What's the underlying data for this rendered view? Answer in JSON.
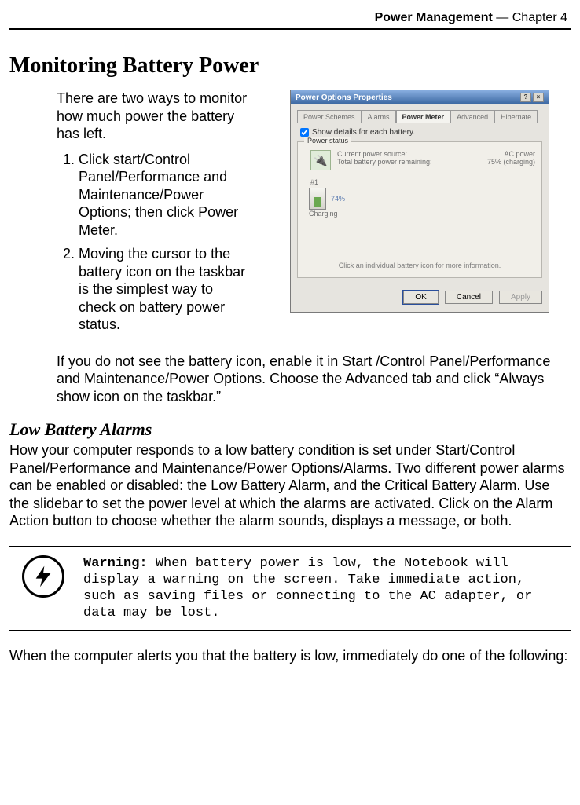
{
  "header": {
    "section": "Power Management",
    "sep": " — ",
    "chapter": "Chapter 4"
  },
  "title": "Monitoring Battery Power",
  "intro": "There are two ways to monitor how much power the battery has left.",
  "steps": [
    "Click start/Control Panel/Performance and Maintenance/Power Options; then click Power Meter.",
    "Moving the cursor to the battery icon on the taskbar is the simplest way to check on battery power status."
  ],
  "dialog": {
    "title": "Power Options Properties",
    "tabs": [
      "Power Schemes",
      "Alarms",
      "Power Meter",
      "Advanced",
      "Hibernate"
    ],
    "active_tab": "Power Meter",
    "checkbox_label": "Show details for each battery.",
    "group_title": "Power status",
    "status": {
      "src_label": "Current power source:",
      "src_value": "AC power",
      "rem_label": "Total battery power remaining:",
      "rem_value": "75%",
      "rem_note": "(charging)"
    },
    "battery_no": "#1",
    "battery_pct": "74%",
    "battery_state": "Charging",
    "hint": "Click an individual battery icon for more information.",
    "buttons": {
      "ok": "OK",
      "cancel": "Cancel",
      "apply": "Apply"
    }
  },
  "after_figure": "If you do not see the battery icon, enable it in Start /Control Panel/Performance and Maintenance/Power Options. Choose the Advanced tab and click “Always show icon on the taskbar.”",
  "subhead": "Low Battery Alarms",
  "alarms_para": "How your computer responds to a low battery condition is set under Start/Control Panel/Performance and Maintenance/Power Options/Alarms. Two different power alarms can be enabled or disabled: the Low Battery Alarm, and the Critical Battery Alarm. Use the slidebar to set the power level at which the alarms are activated. Click on the Alarm Action button to choose whether the alarm sounds, displays a message, or both.",
  "warning": {
    "label": "Warning:",
    "text": " When battery power is low, the Notebook will display a warning on the screen. Take immediate action, such as saving files or connecting to the AC adapter, or data may be lost."
  },
  "tail": "When the computer alerts you that the battery is low, immediately do one of the following:"
}
